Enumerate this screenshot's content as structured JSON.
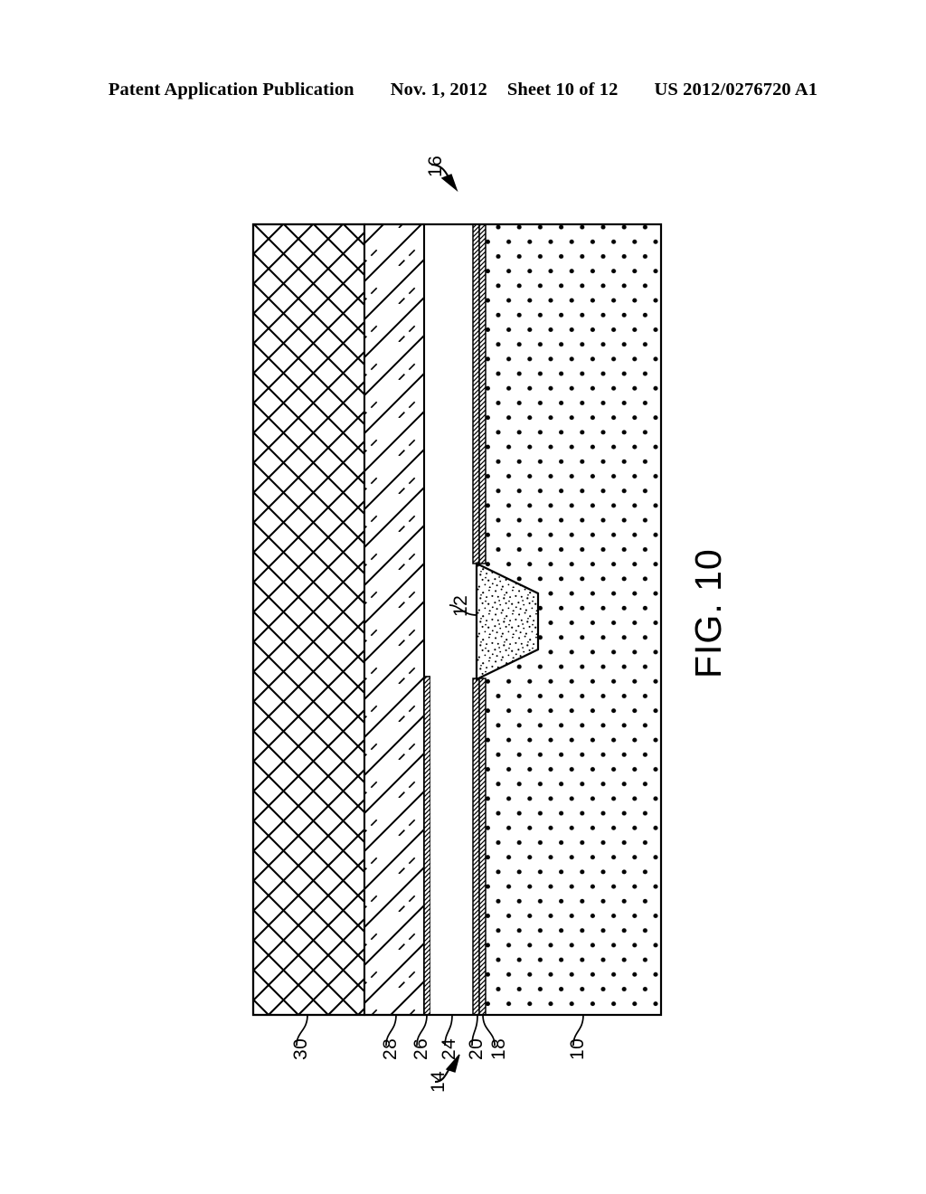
{
  "header": {
    "publication": "Patent Application Publication",
    "date": "Nov. 1, 2012",
    "sheet": "Sheet 10 of 12",
    "docnum": "US 2012/0276720 A1"
  },
  "figure": {
    "label": "FIG. 10",
    "assembly_label": "16",
    "stack_label": "14",
    "feature_label": "12",
    "reference_numbers": [
      {
        "id": "30",
        "label": "30"
      },
      {
        "id": "28",
        "label": "28"
      },
      {
        "id": "26",
        "label": "26"
      },
      {
        "id": "24",
        "label": "24"
      },
      {
        "id": "20",
        "label": "20"
      },
      {
        "id": "18",
        "label": "18"
      },
      {
        "id": "10",
        "label": "10"
      }
    ],
    "layers": [
      {
        "ref": "30",
        "name": "crosshatch-layer",
        "fill": "crosshatch"
      },
      {
        "ref": "28",
        "name": "diagonal-hatch-layer",
        "fill": "diagonal-dashed"
      },
      {
        "ref": "26",
        "name": "thin-film-layer",
        "fill": "fine-vertical"
      },
      {
        "ref": "24",
        "name": "gap-layer",
        "fill": "blank"
      },
      {
        "ref": "20",
        "name": "barrier-layer",
        "fill": "fine-vertical"
      },
      {
        "ref": "18",
        "name": "liner-layer",
        "fill": "fine-vertical"
      },
      {
        "ref": "12",
        "name": "trapezoid-feature",
        "fill": "stipple"
      },
      {
        "ref": "10",
        "name": "substrate-layer",
        "fill": "dot-lattice"
      }
    ],
    "colors": {
      "line": "#000000",
      "background": "#ffffff"
    }
  }
}
